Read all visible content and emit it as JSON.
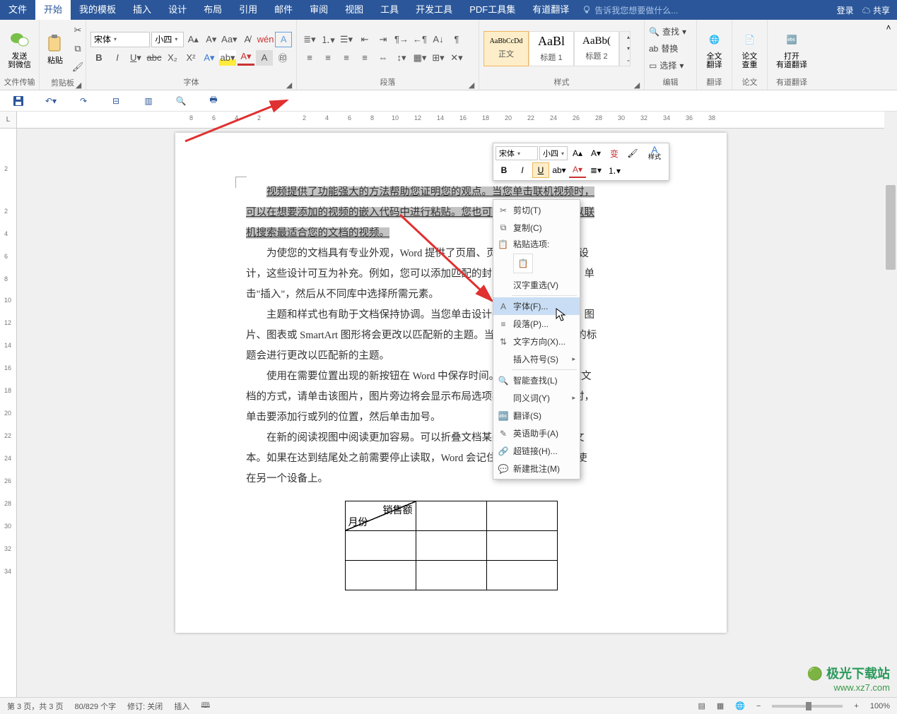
{
  "tabs": {
    "file": "文件",
    "start": "开始",
    "templates": "我的模板",
    "insert": "插入",
    "design": "设计",
    "layout": "布局",
    "references": "引用",
    "mailings": "邮件",
    "review": "审阅",
    "view": "视图",
    "tools": "工具",
    "dev": "开发工具",
    "pdf": "PDF工具集",
    "youdao": "有道翻译"
  },
  "titlebar": {
    "tellme": "告诉我您想要做什么...",
    "login": "登录",
    "share": "共享"
  },
  "ribbon": {
    "clipboard": {
      "send_label": "发送\n到微信",
      "paste_label": "粘贴",
      "group": "文件传输",
      "group2": "剪贴板"
    },
    "font": {
      "family": "宋体",
      "size": "小四",
      "group": "字体"
    },
    "paragraph": {
      "group": "段落"
    },
    "styles": {
      "group": "样式",
      "normal_prev": "AaBbCcDd",
      "normal_name": "正文",
      "h1_prev": "AaBl",
      "h1_name": "标题 1",
      "h2_prev": "AaBb(",
      "h2_name": "标题 2"
    },
    "editing": {
      "find": "查找",
      "replace": "替换",
      "select": "选择",
      "group": "编辑"
    },
    "translate": {
      "full": "全文\n翻译",
      "group": "翻译"
    },
    "duplicate": {
      "lbl": "论文\n查重",
      "group": "论文"
    },
    "openyd": {
      "lbl": "打开\n有道翻译",
      "group": "有道翻译"
    }
  },
  "mini": {
    "font": "宋体",
    "size": "小四",
    "styles_lbl": "样式"
  },
  "context": {
    "cut": "剪切(T)",
    "copy": "复制(C)",
    "paste_opt": "粘贴选项:",
    "hanzi": "汉字重选(V)",
    "font": "字体(F)...",
    "paragraph": "段落(P)...",
    "text_dir": "文字方向(X)...",
    "insert_sym": "插入符号(S)",
    "smart_find": "智能查找(L)",
    "synonym": "同义词(Y)",
    "translate": "翻译(S)",
    "eng_assist": "英语助手(A)",
    "hyperlink": "超链接(H)...",
    "new_comment": "新建批注(M)"
  },
  "doc": {
    "p1a": "视频提供了功能强大的方法帮助您证明您的观点。当您单击联机视频时，",
    "p1b": "可以在想要添加的视频的嵌入代码中进行粘贴。您也可以键入一个关键字以联",
    "p1c": "机搜索最适合您的文档的视频。",
    "p2a": "为使您的文档具有专业外观，Word 提供了页眉、页脚、封面和文本框设",
    "p2b": "计，这些设计可互为补充。例如，您可以添加匹配的封面、页眉和提要栏。单",
    "p2c": "击\"插入\"，然后从不同库中选择所需元素。",
    "p3a": "主题和样式也有助于文档保持协调。当您单击设计并选择新的主题时，图",
    "p3b": "片、图表或 SmartArt 图形将会更改以匹配新的主题。当您应用样式时，您的标",
    "p3c": "题会进行更改以匹配新的主题。",
    "p4a": "使用在需要位置出现的新按钮在 Word 中保存时间。若要更改图片适应文",
    "p4b": "档的方式，请单击该图片，图片旁边将会显示布局选项按钮。当处理表格时，",
    "p4c": "单击要添加行或列的位置，然后单击加号。",
    "p5a": "在新的阅读视图中阅读更加容易。可以折叠文档某些部分并关注所需文",
    "p5b": "本。如果在达到结尾处之前需要停止读取，Word 会记住您的停止位置 - 即使",
    "p5c": "在另一个设备上。",
    "table": {
      "sales": "销售额",
      "month": "月份"
    }
  },
  "status": {
    "page": "第 3 页，共 3 页",
    "words": "80/829 个字",
    "track": "修订: 关闭",
    "insert": "插入",
    "zoom": "100%"
  },
  "ruler_corner": "L",
  "watermark": {
    "logo": "极光下载站",
    "url": "www.xz7.com"
  }
}
